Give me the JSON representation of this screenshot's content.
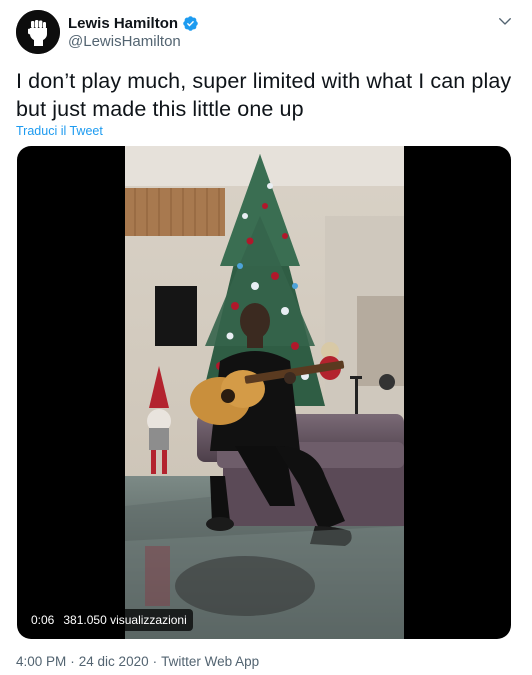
{
  "author": {
    "name": "Lewis Hamilton",
    "handle": "@LewisHamilton",
    "verified": true,
    "avatar_icon": "raised-fist-icon"
  },
  "menu": {
    "icon": "chevron-down-icon"
  },
  "tweet": {
    "text": "I don’t play much, super limited with what I can play but just made this little one up",
    "translate_label": "Traduci il Tweet"
  },
  "video": {
    "duration": "0:06",
    "views": "381.050 visualizzazioni"
  },
  "meta": {
    "time": "4:00 PM",
    "separator_1": "·",
    "date": "24 dic 2020",
    "separator_2": "·",
    "source": "Twitter Web App"
  },
  "colors": {
    "accent": "#1d9bf0",
    "secondary_text": "#536471",
    "primary_text": "#0f1419"
  }
}
